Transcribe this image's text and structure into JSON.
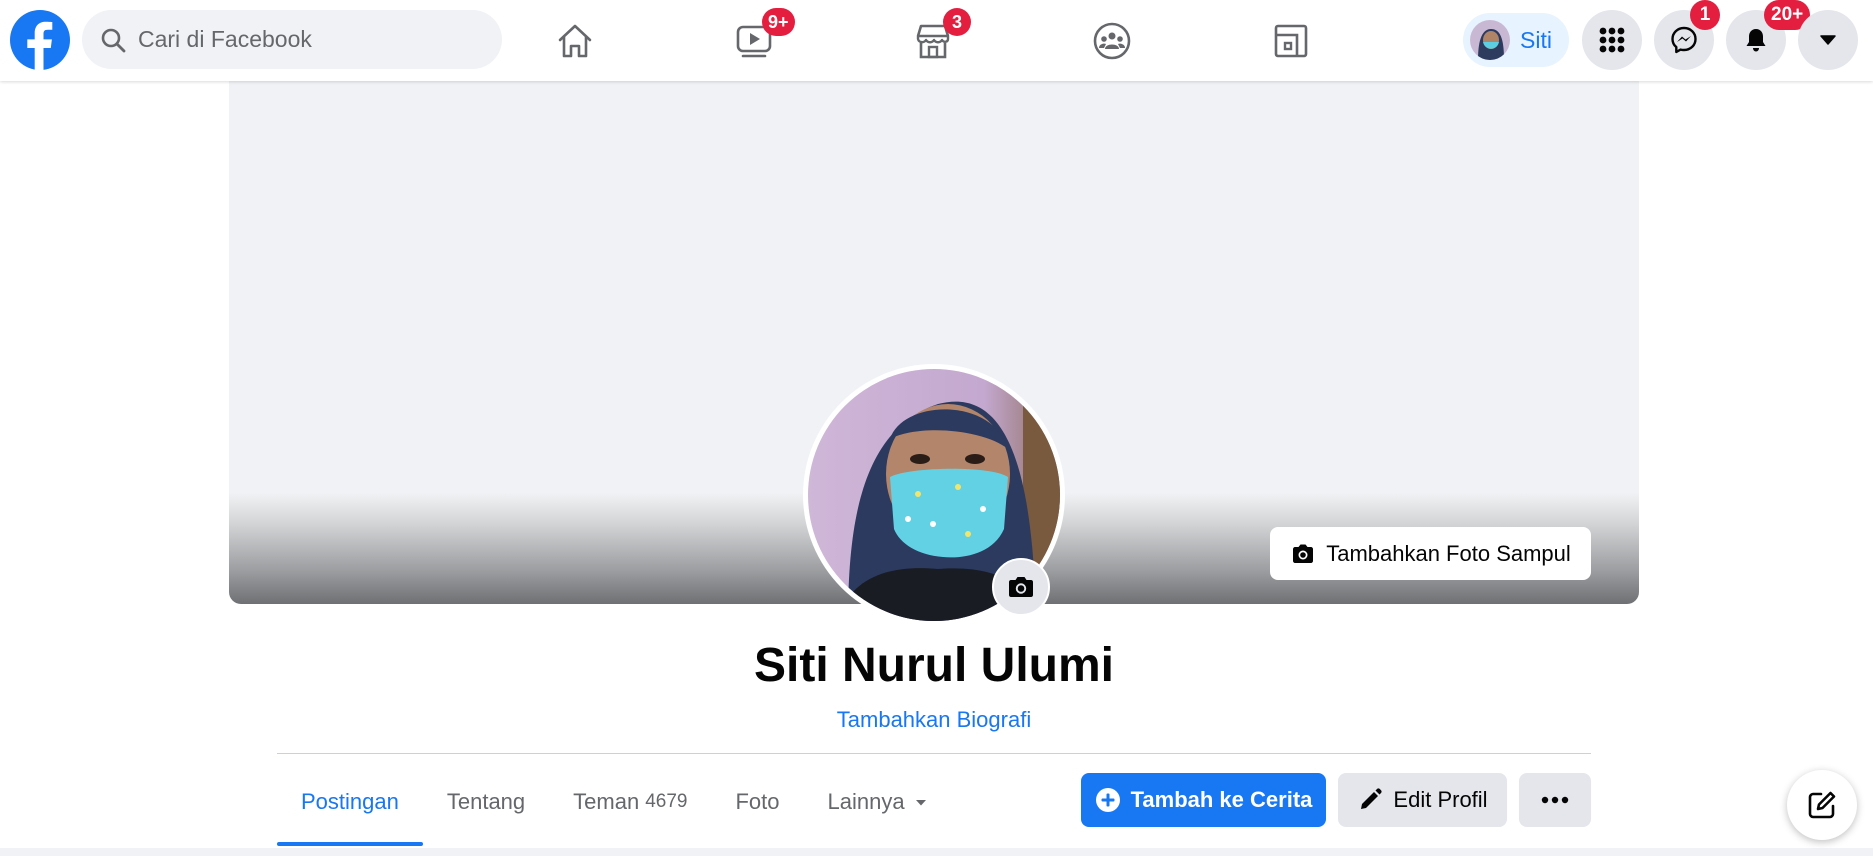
{
  "header": {
    "logo_icon": "facebook-logo-icon",
    "search": {
      "placeholder": "Cari di Facebook",
      "icon": "search-icon"
    },
    "nav": [
      {
        "id": "home",
        "icon": "home-icon",
        "badge": ""
      },
      {
        "id": "watch",
        "icon": "video-icon",
        "badge": "9+"
      },
      {
        "id": "marketplace",
        "icon": "store-icon",
        "badge": "3"
      },
      {
        "id": "groups",
        "icon": "groups-icon",
        "badge": ""
      },
      {
        "id": "gaming",
        "icon": "gaming-icon",
        "badge": ""
      }
    ],
    "profile_chip": {
      "name": "Siti"
    },
    "actions": {
      "menu_icon": "grid-menu-icon",
      "messenger_badge": "1",
      "notifications_badge": "20+",
      "account_icon": "caret-down-icon"
    }
  },
  "cover": {
    "add_cover_label": "Tambahkan Foto Sampul"
  },
  "profile": {
    "name": "Siti Nurul Ulumi",
    "bio_link": "Tambahkan Biografi"
  },
  "tabs": [
    {
      "label": "Postingan",
      "count": "",
      "active": true
    },
    {
      "label": "Tentang",
      "count": ""
    },
    {
      "label": "Teman",
      "count": "4679"
    },
    {
      "label": "Foto",
      "count": ""
    },
    {
      "label": "Lainnya",
      "count": ""
    }
  ],
  "buttons": {
    "add_story": "Tambah ke Cerita",
    "edit_profile": "Edit Profil"
  },
  "colors": {
    "accent": "#1877f2",
    "badge": "#e41e3f",
    "surface": "#f0f2f5",
    "button_gray": "#e4e6eb"
  }
}
